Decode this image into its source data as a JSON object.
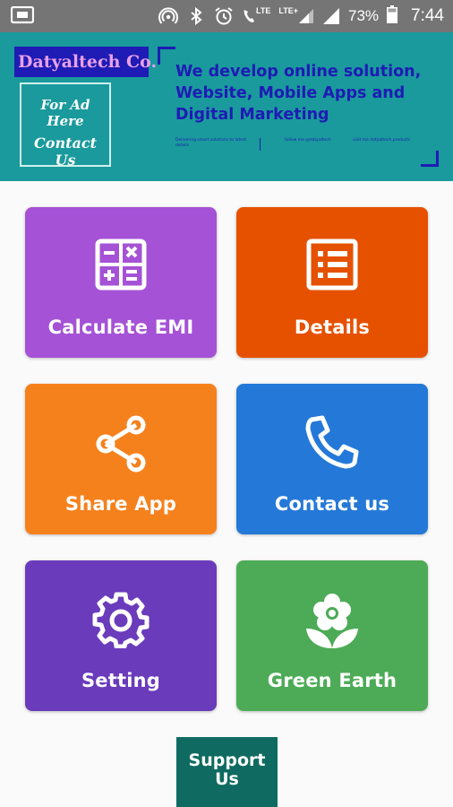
{
  "status_bar": {
    "battery_percent": "73%",
    "time": "7:44",
    "lte_label_1": "LTE",
    "lte_label_2": "LTE+",
    "icons": [
      "screen-cast-icon",
      "hotspot-icon",
      "bluetooth-icon",
      "alarm-icon",
      "volte-call-icon",
      "signal-icon",
      "battery-icon"
    ]
  },
  "ad_banner": {
    "brand": "Datyaltech Co.",
    "ad_line1": "For Ad Here",
    "ad_line2": "Contact Us",
    "headline": "We develop online solution, Website, Mobile Apps and Digital Marketing",
    "tiny_text": [
      "Delivering smart solutions to latest details",
      "follow me @datyaltech",
      "visit me datyaltech.products"
    ],
    "colors": {
      "background": "#1a9a9c",
      "brand_bg": "#1f1bb5",
      "brand_text": "#e8a0e8",
      "headline": "#1f1bb5"
    }
  },
  "tiles": [
    {
      "label": "Calculate EMI",
      "icon": "calculator-icon",
      "color": "#a552d6"
    },
    {
      "label": "Details",
      "icon": "list-details-icon",
      "color": "#e65100"
    },
    {
      "label": "Share App",
      "icon": "share-icon",
      "color": "#f5811d"
    },
    {
      "label": "Contact us",
      "icon": "phone-icon",
      "color": "#2479d8"
    },
    {
      "label": "Setting",
      "icon": "gear-icon",
      "color": "#6a3bbb"
    },
    {
      "label": "Green Earth",
      "icon": "flower-icon",
      "color": "#4dab57"
    }
  ],
  "support_button": {
    "label": "Support Us",
    "color": "#0f6b61"
  }
}
